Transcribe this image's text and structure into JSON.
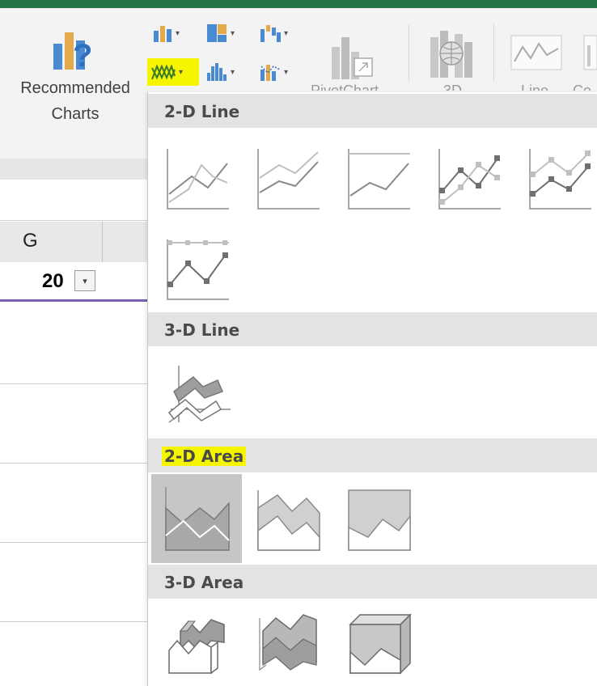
{
  "ribbon": {
    "recommended_label_line1": "Recommended",
    "recommended_label_line2": "Charts",
    "pivotchart_label": "PivotChart",
    "threed_label": "3D",
    "line_label": "Line",
    "column_label": "Co"
  },
  "sheet": {
    "column_header": "G",
    "cell_value": "20",
    "filter_glyph": "▾"
  },
  "menu": {
    "sections": [
      {
        "title": "2-D Line",
        "options": [
          "line",
          "stacked-line",
          "100-stacked-line",
          "line-markers",
          "stacked-line-markers",
          "100-stacked-line-markers"
        ]
      },
      {
        "title": "3-D Line",
        "options": [
          "3d-line"
        ]
      },
      {
        "title": "2-D Area",
        "highlighted": true,
        "options": [
          "area",
          "stacked-area",
          "100-stacked-area"
        ]
      },
      {
        "title": "3-D Area",
        "options": [
          "3d-area",
          "3d-stacked-area",
          "3d-100-stacked-area"
        ]
      }
    ]
  },
  "colors": {
    "excel_green": "#217346",
    "highlight_yellow": "#f6f500",
    "selection_gray": "#c6c6c6",
    "active_cell_underline": "#7b5fb4"
  }
}
